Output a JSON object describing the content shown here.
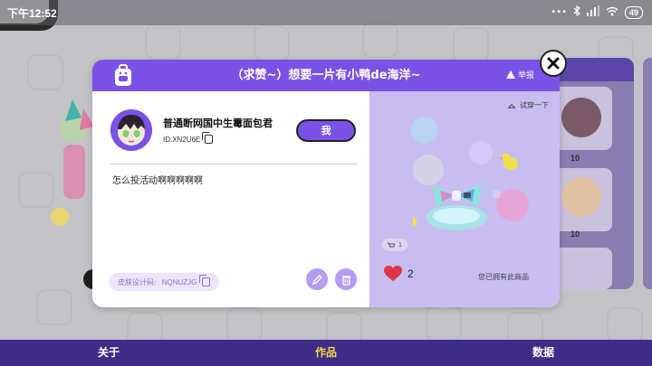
{
  "status_bar": {
    "time": "下午12:52",
    "battery": "49"
  },
  "modal": {
    "title": "（求赞~）想要一片有小鸭de海洋~",
    "report_label": "举报",
    "author": {
      "name": "普通断网国中生霉面包君",
      "id": "ID:XN2U6E"
    },
    "me_button": "我",
    "description": "怎么投活动啊啊啊啊啊",
    "design_code": {
      "label": "皮肤设计码:",
      "value": "NQNUZJG"
    },
    "preview": {
      "try_on_label": "试穿一下",
      "cart_count": "1",
      "likes": "2",
      "owned_text": "您已拥有此商品"
    }
  },
  "background": {
    "card_prices": [
      "10",
      "10"
    ]
  },
  "bottom_nav": {
    "tabs": [
      {
        "label": "关于",
        "active": false
      },
      {
        "label": "作品",
        "active": true
      },
      {
        "label": "数据",
        "active": false
      }
    ]
  },
  "colors": {
    "accent": "#7b52e6",
    "nav_bg": "#3e2c86",
    "nav_active": "#f5d94a",
    "heart": "#e0344a"
  },
  "icons": [
    "backpack-icon",
    "warning-icon",
    "close-icon",
    "copy-icon",
    "pencil-icon",
    "trash-icon",
    "hanger-icon",
    "cart-icon",
    "heart-icon",
    "bluetooth-icon",
    "signal-icon",
    "wifi-icon"
  ]
}
